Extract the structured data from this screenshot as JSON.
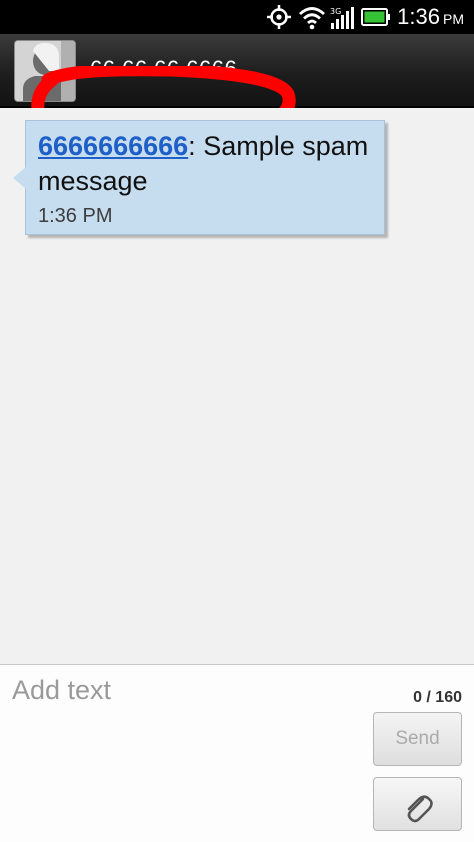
{
  "status_bar": {
    "icons": [
      "gps-icon",
      "wifi-icon",
      "signal-icon",
      "battery-icon"
    ],
    "time": "1:36",
    "ampm": "PM"
  },
  "header": {
    "contact_number": "66 66 66 6666",
    "annotation_color": "#ff0000"
  },
  "conversation": {
    "messages": [
      {
        "sender": "6666666666",
        "separator": ":",
        "text": " Sample spam message",
        "time": "1:36 PM"
      }
    ]
  },
  "compose": {
    "placeholder": "Add text",
    "counter": "0 / 160",
    "send_label": "Send",
    "attach_icon": "paperclip-icon"
  },
  "colors": {
    "bubble": "#c6dcef",
    "link": "#1e5fc8",
    "battery": "#36c236"
  }
}
